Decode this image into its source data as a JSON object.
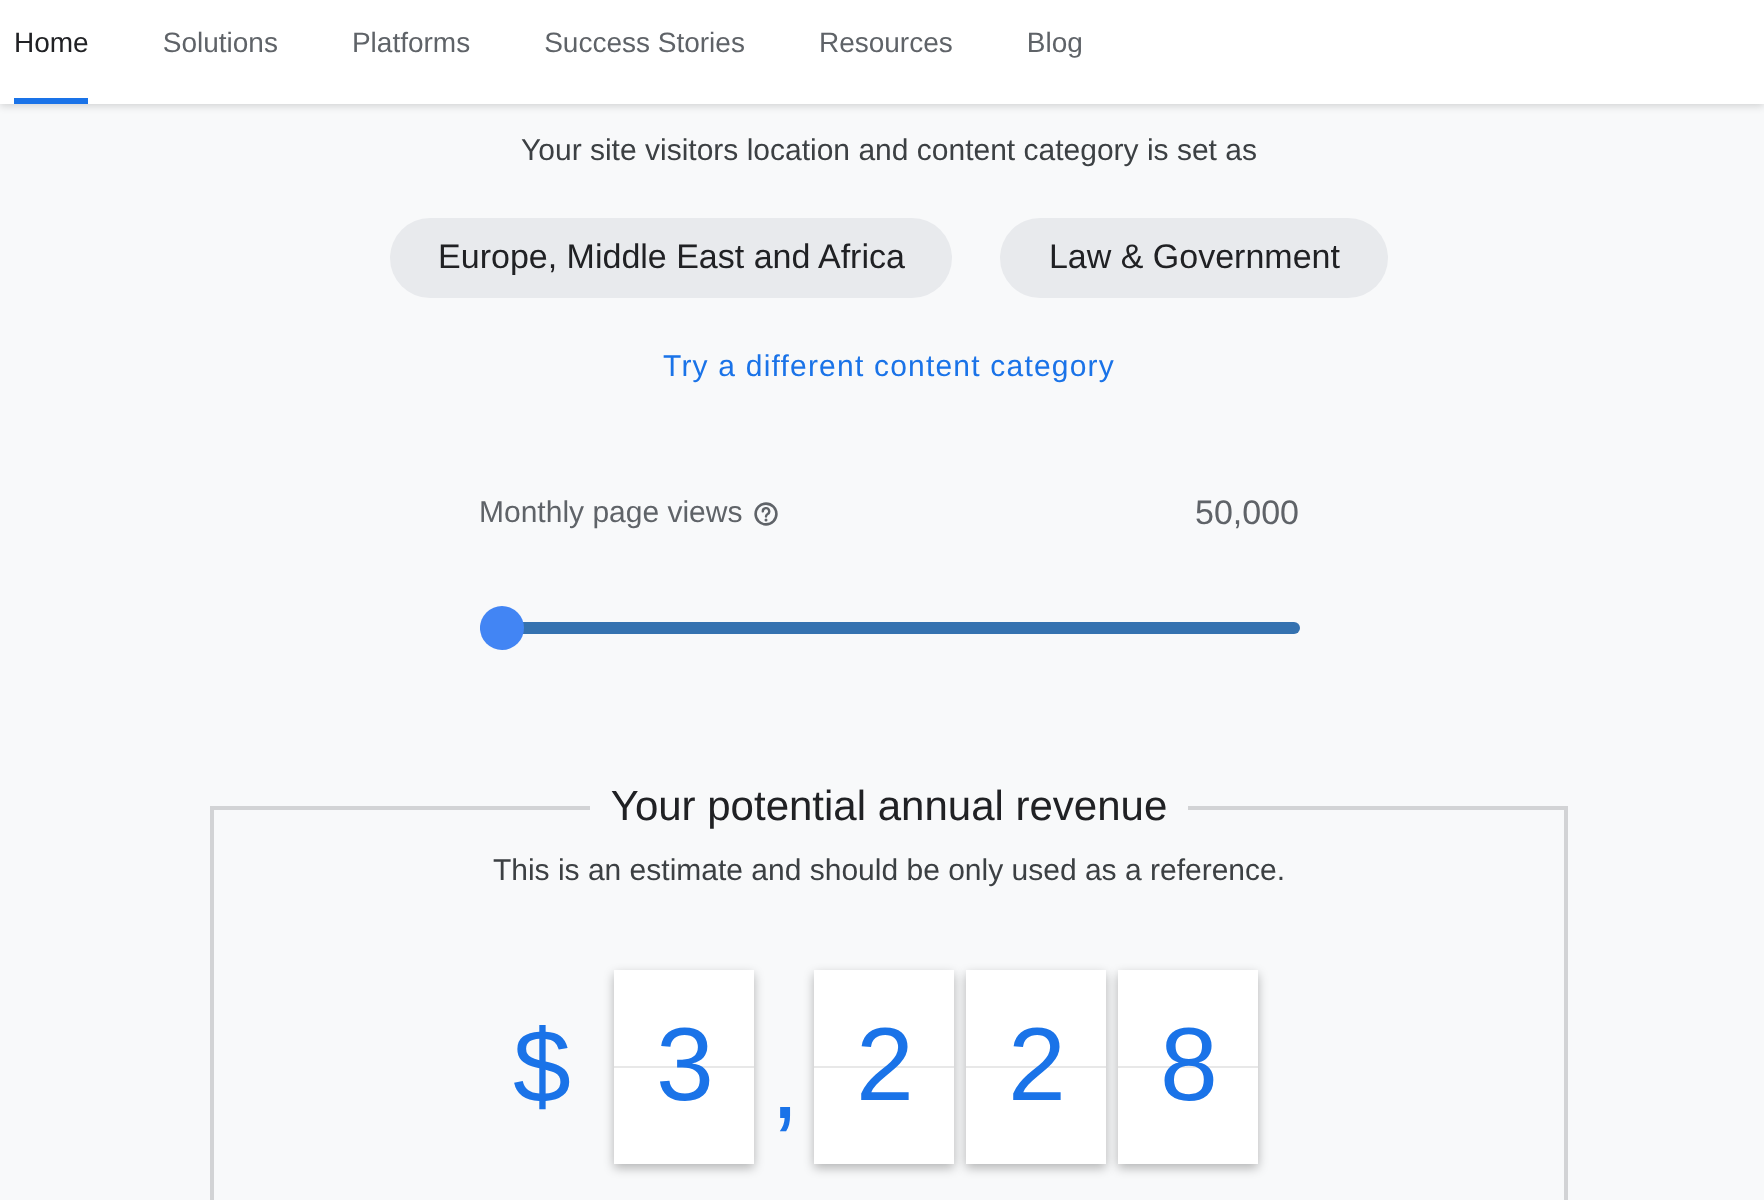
{
  "nav": {
    "tabs": [
      {
        "label": "Home",
        "selected": true
      },
      {
        "label": "Solutions",
        "selected": false
      },
      {
        "label": "Platforms",
        "selected": false
      },
      {
        "label": "Success Stories",
        "selected": false
      },
      {
        "label": "Resources",
        "selected": false
      },
      {
        "label": "Blog",
        "selected": false
      }
    ]
  },
  "audience": {
    "intro": "Your site visitors location and content category is set as",
    "chips": [
      "Europe, Middle East and Africa",
      "Law & Government"
    ],
    "link": "Try a different content category"
  },
  "page_views": {
    "label": "Monthly page views",
    "value": "50,000",
    "level": 0
  },
  "revenue": {
    "title": "Your potential annual revenue",
    "note": "This is an estimate and should be only used as a reference.",
    "currency": "$",
    "digits": [
      {
        "kind": "digit",
        "text": "3"
      },
      {
        "kind": "separator",
        "text": ","
      },
      {
        "kind": "digit",
        "text": "2"
      },
      {
        "kind": "digit",
        "text": "2"
      },
      {
        "kind": "digit",
        "text": "8"
      }
    ]
  }
}
